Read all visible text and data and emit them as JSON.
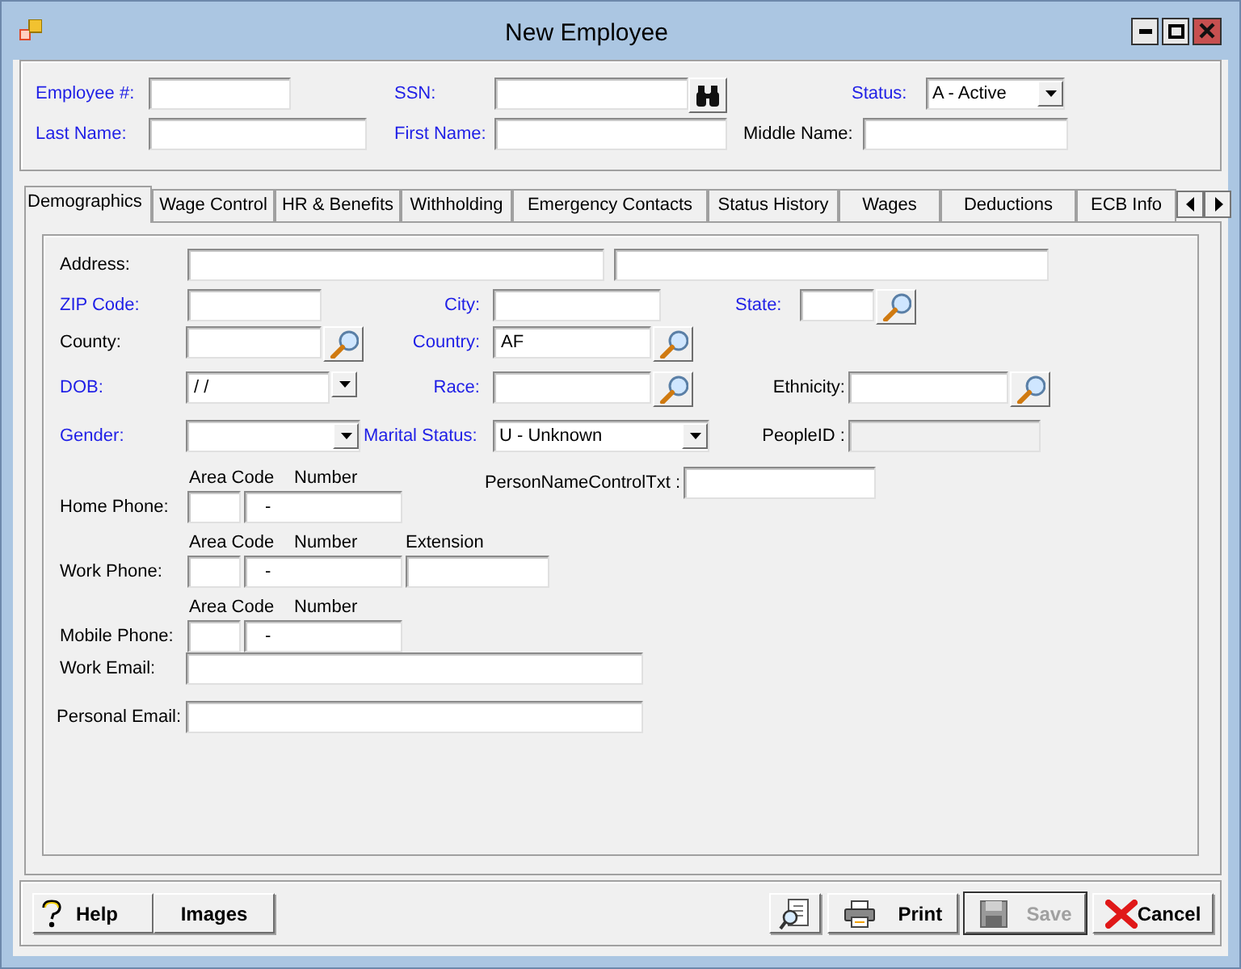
{
  "window": {
    "title": "New Employee"
  },
  "header": {
    "rows": [
      {
        "fields": [
          {
            "kind": "text",
            "label": "Employee #:",
            "required": true
          },
          {
            "kind": "binoculars",
            "label": "SSN:",
            "required": true
          },
          {
            "kind": "select",
            "label": "Status:",
            "required": true,
            "value": "A - Active"
          }
        ]
      },
      {
        "fields": [
          {
            "kind": "text",
            "label": "Last Name:",
            "required": true
          },
          {
            "kind": "text",
            "label": "First Name:",
            "required": true
          },
          {
            "kind": "text",
            "label": "Middle Name:",
            "required": false
          }
        ]
      }
    ]
  },
  "tabs": [
    {
      "label": "Demographics",
      "selected": true
    },
    {
      "label": "Wage Control",
      "selected": false
    },
    {
      "label": "HR & Benefits",
      "selected": false
    },
    {
      "label": "Withholding",
      "selected": false
    },
    {
      "label": "Emergency Contacts",
      "selected": false
    },
    {
      "label": "Status History",
      "selected": false
    },
    {
      "label": "Wages",
      "selected": false
    },
    {
      "label": "Deductions",
      "selected": false
    },
    {
      "label": "ECB Info",
      "selected": false
    }
  ],
  "demographics": {
    "rows": [
      {
        "fields": [
          {
            "kind": "address",
            "label": "Address:",
            "required": false
          }
        ]
      },
      {
        "fields": [
          {
            "kind": "text",
            "label": "ZIP Code:",
            "required": true
          },
          {
            "kind": "text",
            "label": "City:",
            "required": true
          },
          {
            "kind": "lookup",
            "label": "State:",
            "required": true
          }
        ]
      },
      {
        "fields": [
          {
            "kind": "lookup",
            "label": "County:",
            "required": false
          },
          {
            "kind": "lookup",
            "label": "Country:",
            "required": true,
            "value": "AF"
          }
        ]
      },
      {
        "fields": [
          {
            "kind": "date",
            "label": "DOB:",
            "required": true,
            "value": "/ /"
          },
          {
            "kind": "lookup",
            "label": "Race:",
            "required": true
          },
          {
            "kind": "lookup",
            "label": "Ethnicity:",
            "required": false
          }
        ]
      },
      {
        "fields": [
          {
            "kind": "select",
            "label": "Gender:",
            "required": true
          },
          {
            "kind": "select",
            "label": "Marital Status:",
            "required": true,
            "value": "U - Unknown"
          },
          {
            "kind": "text",
            "label": "PeopleID :",
            "required": false,
            "disabled": true
          }
        ]
      },
      {
        "fields": [
          {
            "kind": "phone",
            "label": "Home Phone:",
            "required": false,
            "parts": [
              {
                "heading": "Area Code"
              },
              {
                "heading": "Number",
                "value": "-"
              }
            ]
          },
          {
            "kind": "text",
            "label": "PersonNameControlTxt :",
            "required": false
          }
        ]
      },
      {
        "fields": [
          {
            "kind": "phone",
            "label": "Work Phone:",
            "required": false,
            "parts": [
              {
                "heading": "Area Code"
              },
              {
                "heading": "Number",
                "value": "-"
              },
              {
                "heading": "Extension"
              }
            ]
          }
        ]
      },
      {
        "fields": [
          {
            "kind": "phone",
            "label": "Mobile Phone:",
            "required": false,
            "parts": [
              {
                "heading": "Area Code"
              },
              {
                "heading": "Number",
                "value": "-"
              }
            ]
          }
        ]
      },
      {
        "fields": [
          {
            "kind": "text",
            "label": "Work Email:",
            "required": false
          }
        ]
      },
      {
        "fields": [
          {
            "kind": "text",
            "label": "Personal Email:",
            "required": false
          }
        ]
      }
    ]
  },
  "buttons": [
    {
      "kind": "help",
      "label": "Help",
      "disabled": false
    },
    {
      "kind": "plain",
      "label": "Images",
      "disabled": false
    },
    {
      "kind": "preview",
      "disabled": false
    },
    {
      "kind": "print",
      "label": "Print",
      "disabled": false
    },
    {
      "kind": "save",
      "label": "Save",
      "disabled": true
    },
    {
      "kind": "cancel",
      "label": "Cancel",
      "disabled": false
    }
  ]
}
